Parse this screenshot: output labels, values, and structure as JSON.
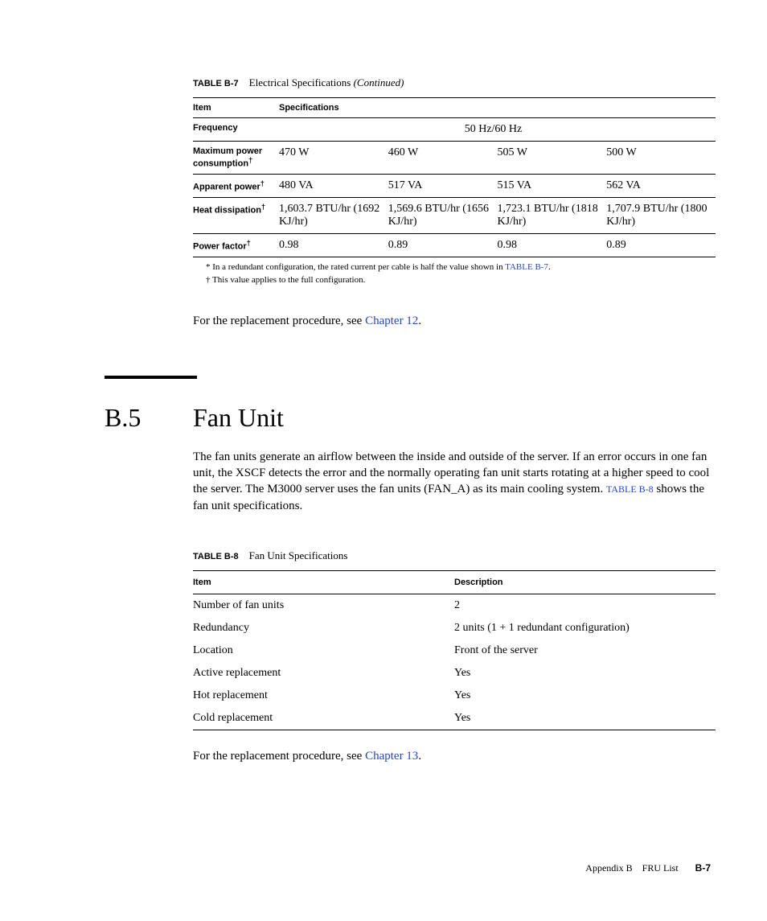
{
  "table1": {
    "caption_label": "TABLE B-7",
    "caption_title": "Electrical Specifications",
    "caption_suffix": "(Continued)",
    "headers": {
      "item": "Item",
      "spec": "Specifications"
    },
    "rows": {
      "frequency": {
        "label": "Frequency",
        "value": "50 Hz/60 Hz"
      },
      "max_power": {
        "label": "Maximum power consumption",
        "dagger": "†",
        "c1": "470 W",
        "c2": "460 W",
        "c3": "505 W",
        "c4": "500 W"
      },
      "apparent": {
        "label": "Apparent power",
        "dagger": "†",
        "c1": "480 VA",
        "c2": "517 VA",
        "c3": "515 VA",
        "c4": "562 VA"
      },
      "heat": {
        "label": "Heat dissipation",
        "dagger": "†",
        "c1": "1,603.7 BTU/hr (1692 KJ/hr)",
        "c2": "1,569.6 BTU/hr (1656 KJ/hr)",
        "c3": "1,723.1 BTU/hr (1818 KJ/hr)",
        "c4": "1,707.9 BTU/hr (1800 KJ/hr)"
      },
      "pf": {
        "label": "Power factor",
        "dagger": "†",
        "c1": "0.98",
        "c2": "0.89",
        "c3": "0.98",
        "c4": "0.89"
      }
    },
    "footnote_star": "* In a redundant configuration, the rated current per cable is half the value shown in ",
    "footnote_star_link": "TABLE B-7",
    "footnote_star_after": ".",
    "footnote_dagger": "† This value applies to the full configuration."
  },
  "replacement1": {
    "text": "For the replacement procedure, see ",
    "link": "Chapter 12",
    "after": "."
  },
  "section": {
    "num": "B.5",
    "title": "Fan Unit",
    "intro_a": "The fan units generate an airflow between the inside and outside of the server. If an error occurs in one fan unit, the XSCF detects the error and the normally operating fan unit starts rotating at a higher speed to cool the server. The M3000 server uses the fan units (FAN_A) as its main cooling system. ",
    "intro_link": "TABLE B-8",
    "intro_b": " shows the fan unit specifications."
  },
  "table2": {
    "caption_label": "TABLE B-8",
    "caption_title": "Fan Unit Specifications",
    "headers": {
      "item": "Item",
      "desc": "Description"
    },
    "rows": [
      {
        "item": "Number of fan units",
        "desc": "2"
      },
      {
        "item": "Redundancy",
        "desc": "2 units (1 + 1 redundant configuration)"
      },
      {
        "item": "Location",
        "desc": "Front of the server"
      },
      {
        "item": "Active replacement",
        "desc": "Yes"
      },
      {
        "item": "Hot replacement",
        "desc": "Yes"
      },
      {
        "item": "Cold replacement",
        "desc": "Yes"
      }
    ]
  },
  "replacement2": {
    "text": "For the replacement procedure, see ",
    "link": "Chapter 13",
    "after": "."
  },
  "footer": {
    "appendix": "Appendix B",
    "title": "FRU List",
    "page": "B-7"
  }
}
